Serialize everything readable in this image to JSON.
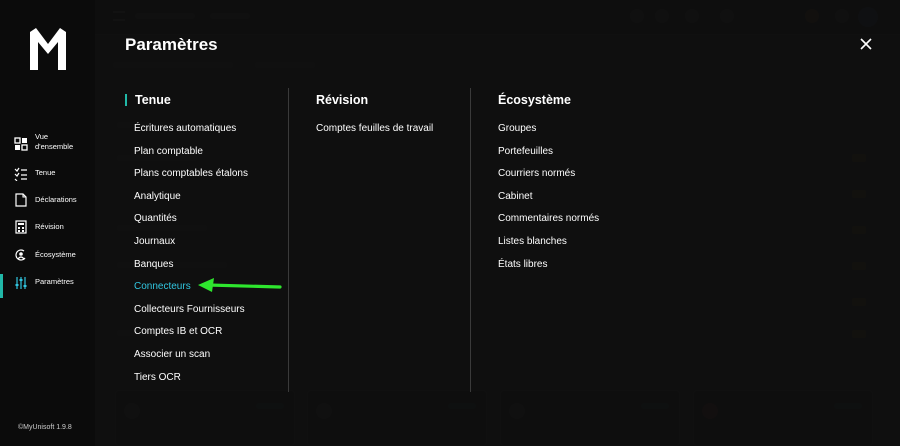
{
  "sidebar": {
    "logo": "M",
    "items": [
      {
        "label": "Vue d'ensemble",
        "icon": "dashboard-grid-icon",
        "active": false
      },
      {
        "label": "Tenue",
        "icon": "list-checklist-icon",
        "active": false
      },
      {
        "label": "Déclarations",
        "icon": "document-declaration-icon",
        "active": false
      },
      {
        "label": "Révision",
        "icon": "calculator-icon",
        "active": false
      },
      {
        "label": "Écosystème",
        "icon": "ecosystem-person-icon",
        "active": false
      },
      {
        "label": "Paramètres",
        "icon": "sliders-settings-icon",
        "active": true
      }
    ],
    "footer": "©MyUnisoft 1.9.8"
  },
  "panel": {
    "title": "Paramètres",
    "close_icon": "close-icon",
    "columns": [
      {
        "heading": "Tenue",
        "items": [
          "Écritures automatiques",
          "Plan comptable",
          "Plans comptables étalons",
          "Analytique",
          "Quantités",
          "Journaux",
          "Banques",
          "Connecteurs",
          "Collecteurs Fournisseurs",
          "Comptes IB et OCR",
          "Associer un scan",
          "Tiers OCR"
        ],
        "active_item": "Connecteurs"
      },
      {
        "heading": "Révision",
        "items": [
          "Comptes feuilles de travail"
        ]
      },
      {
        "heading": "Écosystème",
        "items": [
          "Groupes",
          "Portefeuilles",
          "Courriers normés",
          "Cabinet",
          "Commentaires normés",
          "Listes blanches",
          "États libres"
        ]
      }
    ]
  },
  "annotation": {
    "type": "arrow",
    "color": "#2ee62e",
    "points_to": "Connecteurs"
  },
  "colors": {
    "accent": "#21b8a8",
    "active_link": "#31c6e0",
    "sidebar_bg": "#0b0b0b",
    "overlay_bg": "#0c0c0c"
  }
}
